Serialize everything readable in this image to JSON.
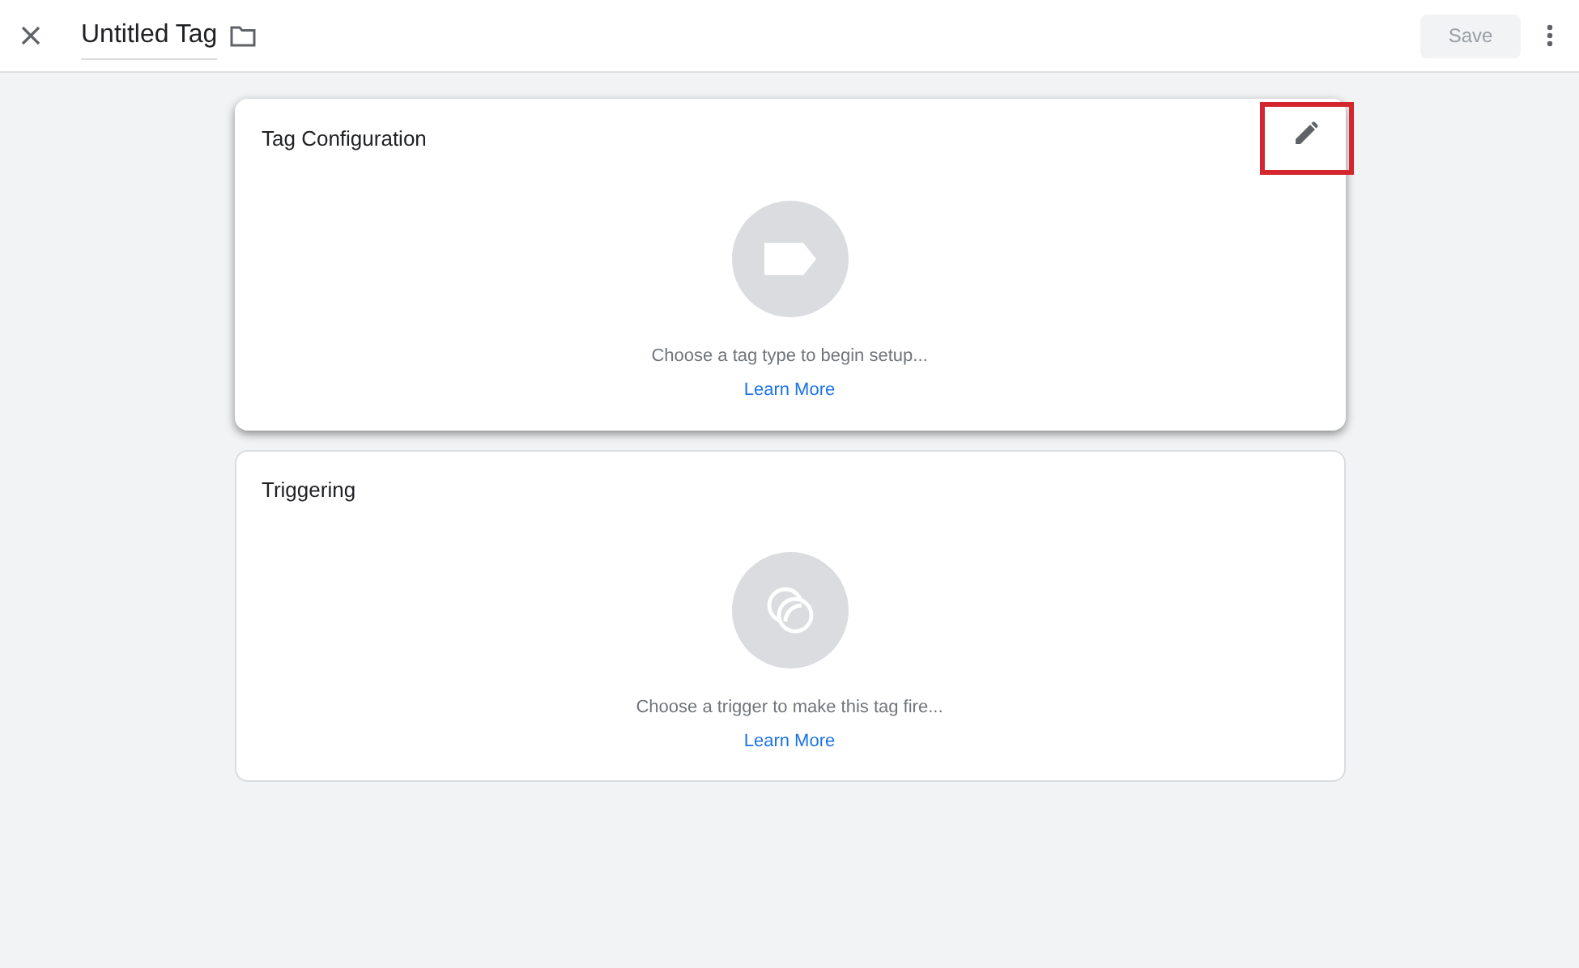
{
  "header": {
    "title": "Untitled Tag",
    "save_button": {
      "label": "Save",
      "disabled": true
    }
  },
  "sections": [
    {
      "title": "Tag Configuration",
      "kind": "tag",
      "raised": true,
      "edit_highlighted": true,
      "message": "Choose a tag type to begin setup...",
      "link": "Learn More"
    },
    {
      "title": "Triggering",
      "kind": "trigger",
      "raised": false,
      "edit_highlighted": false,
      "message": "Choose a trigger to make this tag fire...",
      "link": "Learn More"
    }
  ]
}
